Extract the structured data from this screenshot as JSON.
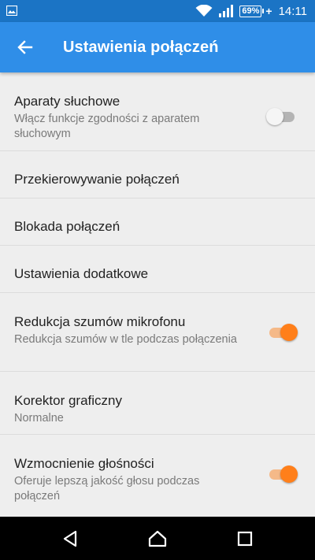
{
  "status_bar": {
    "icons": [
      "image-icon",
      "wifi-icon",
      "signal-icon"
    ],
    "battery_percent": "69%",
    "charging": true,
    "time": "14:11"
  },
  "app_bar": {
    "title": "Ustawienia połączeń",
    "back_icon": "arrow-left-icon"
  },
  "settings": [
    {
      "title": "Aparaty słuchowe",
      "subtitle": "Włącz funkcje zgodności z aparatem słuchowym",
      "toggle": false
    },
    {
      "title": "Przekierowywanie połączeń"
    },
    {
      "title": "Blokada połączeń"
    },
    {
      "title": "Ustawienia dodatkowe"
    },
    {
      "title": "Redukcja szumów mikrofonu",
      "subtitle": "Redukcja szumów w tle podczas połączenia",
      "toggle": true
    },
    {
      "title": "Korektor graficzny",
      "subtitle": "Normalne"
    },
    {
      "title": "Wzmocnienie głośności",
      "subtitle": "Oferuje lepszą jakość głosu podczas połączeń",
      "toggle": true
    }
  ],
  "nav_bar": {
    "icons": [
      "back-triangle-icon",
      "home-icon",
      "recents-icon"
    ]
  },
  "colors": {
    "status_bar": "#1b74c5",
    "app_bar": "#2f8ee8",
    "accent": "#ff7f1a",
    "background": "#eeeeee"
  }
}
